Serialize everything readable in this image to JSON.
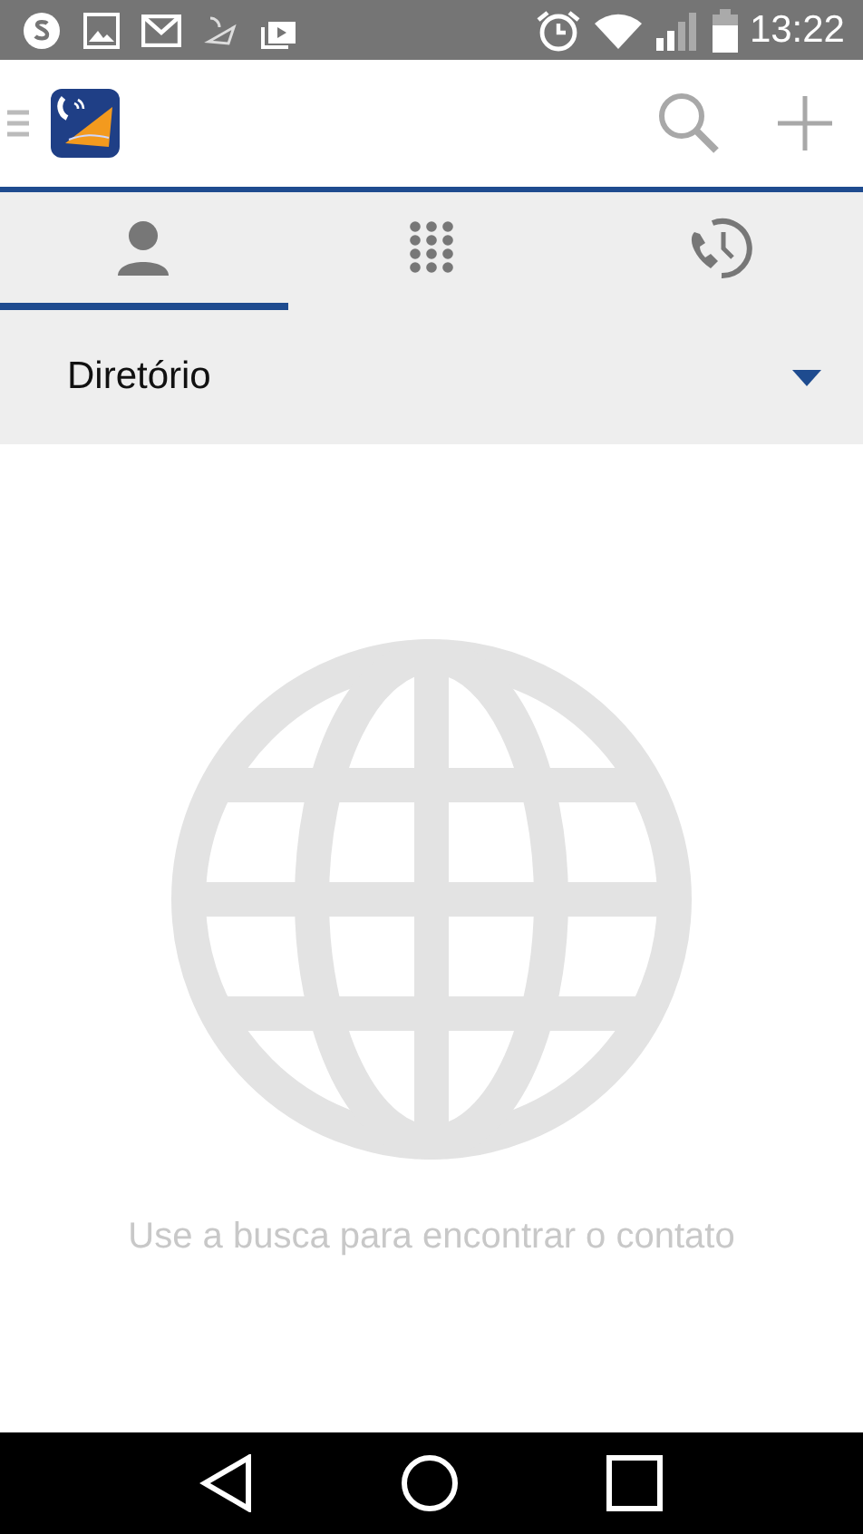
{
  "status_bar": {
    "time": "13:22"
  },
  "tabs": [
    {
      "kind": "contacts",
      "selected": true
    },
    {
      "kind": "dialpad",
      "selected": false
    },
    {
      "kind": "history",
      "selected": false
    }
  ],
  "directory_dropdown": {
    "value": "Diretório"
  },
  "empty_state": {
    "message": "Use a busca para encontrar o contato"
  }
}
